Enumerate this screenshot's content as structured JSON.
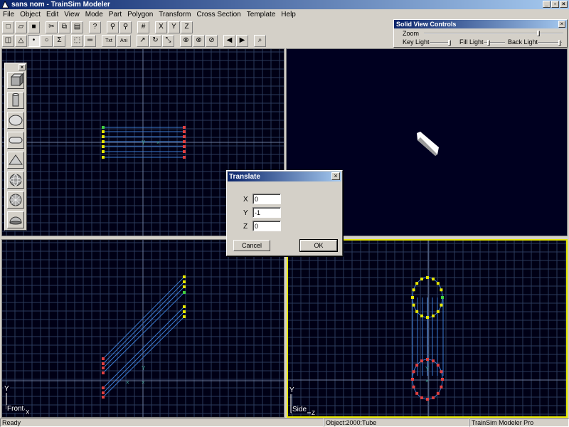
{
  "window": {
    "title": "sans nom - TrainSim Modeler"
  },
  "menu": [
    "File",
    "Object",
    "Edit",
    "View",
    "Mode",
    "Part",
    "Polygon",
    "Transform",
    "Cross Section",
    "Template",
    "Help"
  ],
  "toolbar1": [
    {
      "name": "new-file-icon",
      "glyph": "□"
    },
    {
      "name": "open-folder-icon",
      "glyph": "▱"
    },
    {
      "name": "save-icon",
      "glyph": "■"
    },
    {
      "sep": true
    },
    {
      "name": "cut-icon",
      "glyph": "✂"
    },
    {
      "name": "copy-icon",
      "glyph": "⧉"
    },
    {
      "name": "paste-icon",
      "glyph": "▤"
    },
    {
      "sep": true
    },
    {
      "name": "help-icon",
      "glyph": "?"
    },
    {
      "sep": true
    },
    {
      "name": "zoom-in-icon",
      "glyph": "⚲"
    },
    {
      "name": "zoom-out-icon",
      "glyph": "⚲"
    },
    {
      "sep": true
    },
    {
      "name": "grid-icon",
      "glyph": "#"
    },
    {
      "sep": true
    },
    {
      "name": "axis-x-icon",
      "glyph": "X"
    },
    {
      "name": "axis-y-icon",
      "glyph": "Y"
    },
    {
      "name": "axis-z-icon",
      "glyph": "Z"
    }
  ],
  "toolbar2": [
    {
      "name": "select-face-icon",
      "glyph": "◫"
    },
    {
      "name": "triangle-icon",
      "glyph": "△"
    },
    {
      "name": "point-icon",
      "glyph": "•",
      "active": true
    },
    {
      "name": "circle-icon",
      "glyph": "○"
    },
    {
      "name": "sigma-icon",
      "glyph": "Σ"
    },
    {
      "sep": true
    },
    {
      "name": "marquee-select-icon",
      "glyph": "⬚"
    },
    {
      "name": "ruler-icon",
      "glyph": "═"
    },
    {
      "sep": true
    },
    {
      "name": "texture-icon",
      "glyph": "Txt",
      "wide": true
    },
    {
      "name": "animation-icon",
      "glyph": "Ani",
      "wide": true
    },
    {
      "sep": true
    },
    {
      "name": "move-icon",
      "glyph": "↗"
    },
    {
      "name": "rotate-icon",
      "glyph": "↻"
    },
    {
      "name": "scale-icon",
      "glyph": "⤡"
    },
    {
      "sep": true
    },
    {
      "name": "no-x-icon",
      "glyph": "⊗"
    },
    {
      "name": "no-y-icon",
      "glyph": "⊗"
    },
    {
      "name": "no-z-icon",
      "glyph": "⊘"
    },
    {
      "sep": true
    },
    {
      "name": "prev-icon",
      "glyph": "◀"
    },
    {
      "name": "next-icon",
      "glyph": "▶"
    },
    {
      "sep": true
    },
    {
      "name": "binoculars-icon",
      "glyph": "⌕"
    }
  ],
  "solid_view": {
    "title": "Solid View Controls",
    "zoom_label": "Zoom",
    "key_light_label": "Key Light",
    "fill_light_label": "Fill Light",
    "back_light_label": "Back Light",
    "zoom_level": 0.82,
    "key_light": 1.0,
    "fill_light": 0.22,
    "back_light": 0.92
  },
  "palette": {
    "items": [
      "box-shape-icon",
      "cylinder-shape-icon",
      "disc-shape-icon",
      "capsule-shape-icon",
      "cone-shape-icon",
      "sphere-shape-icon",
      "geosphere-shape-icon",
      "hemisphere-shape-icon"
    ]
  },
  "viewports": {
    "front_label": "Front",
    "side_label": "Side",
    "axis_y": "Y",
    "axis_x": "X",
    "axis_z": "Z"
  },
  "dialog": {
    "title": "Translate",
    "x_label": "X",
    "y_label": "Y",
    "z_label": "Z",
    "x_value": "0",
    "y_value": "-1",
    "z_value": "0",
    "cancel_label": "Cancel",
    "ok_label": "OK"
  },
  "status": {
    "left": "Ready",
    "object": "Object:2000:Tube",
    "product": "TrainSim Modeler Pro"
  }
}
